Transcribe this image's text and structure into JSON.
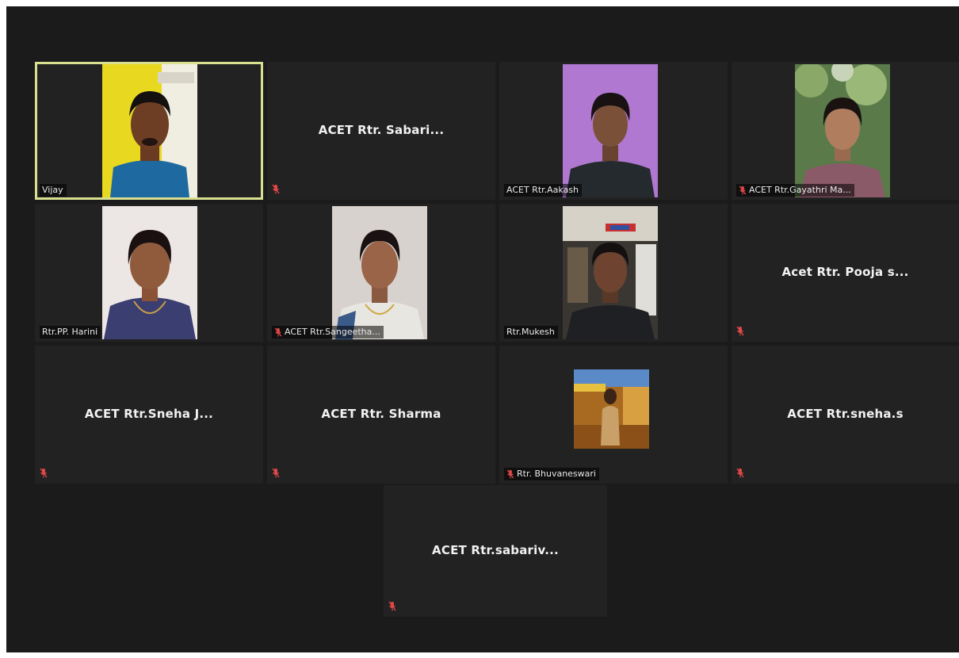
{
  "meeting": {
    "tiles": [
      {
        "id": "vijay",
        "name": "Vijay",
        "label": "Vijay",
        "video": true,
        "muted": false,
        "active": true
      },
      {
        "id": "sabari",
        "name": "ACET Rtr. Sabari...",
        "video": false,
        "muted": true
      },
      {
        "id": "aakash",
        "name": "ACET Rtr.Aakash",
        "label": "ACET Rtr.Aakash",
        "video": true,
        "muted": false
      },
      {
        "id": "gayathri",
        "name": "ACET Rtr.Gayathri Ma...",
        "label": "ACET Rtr.Gayathri Ma...",
        "video": true,
        "muted": true
      },
      {
        "id": "harini",
        "name": "Rtr.PP. Harini",
        "label": "Rtr.PP. Harini",
        "video": true,
        "muted": false
      },
      {
        "id": "sangeetha",
        "name": "ACET Rtr.Sangeetha...",
        "label": "ACET Rtr.Sangeetha...",
        "video": true,
        "muted": true
      },
      {
        "id": "mukesh",
        "name": "Rtr.Mukesh",
        "label": "Rtr.Mukesh",
        "video": true,
        "muted": false
      },
      {
        "id": "pooja",
        "name": "Acet Rtr. Pooja s...",
        "video": false,
        "muted": true
      },
      {
        "id": "sneha-j",
        "name": "ACET Rtr.Sneha J...",
        "video": false,
        "muted": true
      },
      {
        "id": "sharma",
        "name": "ACET Rtr. Sharma",
        "video": false,
        "muted": true
      },
      {
        "id": "bhuvaneswari",
        "name": "Rtr. Bhuvaneswari",
        "label": "Rtr. Bhuvaneswari",
        "video": true,
        "muted": true
      },
      {
        "id": "sneha-s",
        "name": "ACET Rtr.sneha.s",
        "video": false,
        "muted": true
      },
      {
        "id": "sabariv",
        "name": "ACET Rtr.sabariv...",
        "video": false,
        "muted": true
      }
    ]
  },
  "icons": {
    "muted_mic": "muted-mic-icon"
  },
  "colors": {
    "background": "#1b1b1b",
    "tile": "#222222",
    "active_speaker_border": "#d8e090",
    "muted_icon": "#e04848",
    "name_text": "#f2f2f2"
  }
}
